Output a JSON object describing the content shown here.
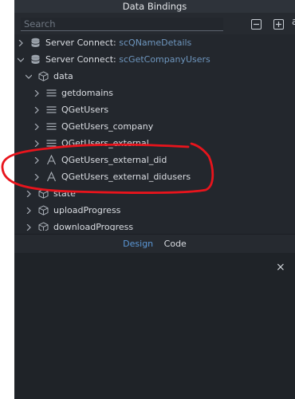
{
  "window": {
    "title": "Data Bindings"
  },
  "search": {
    "placeholder": "Search"
  },
  "tree": {
    "items": [
      {
        "prefix": "Server Connect: ",
        "source": "scQNameDetails"
      },
      {
        "prefix": "Server Connect: ",
        "source": "scGetCompanyUsers"
      },
      {
        "label": "data"
      },
      {
        "label": "getdomains"
      },
      {
        "label": "QGetUsers"
      },
      {
        "label": "QGetUsers_company"
      },
      {
        "label": "QGetUsers_external"
      },
      {
        "label": "QGetUsers_external_did"
      },
      {
        "label": "QGetUsers_external_didusers"
      },
      {
        "label": "state"
      },
      {
        "label": "uploadProgress"
      },
      {
        "label": "downloadProgress"
      }
    ]
  },
  "tabs": {
    "design": "Design",
    "code": "Code"
  },
  "colors": {
    "panel_bg": "#23272d",
    "accent": "#5b97d6",
    "source_text": "#6e96be",
    "annotation": "#e8141c"
  }
}
